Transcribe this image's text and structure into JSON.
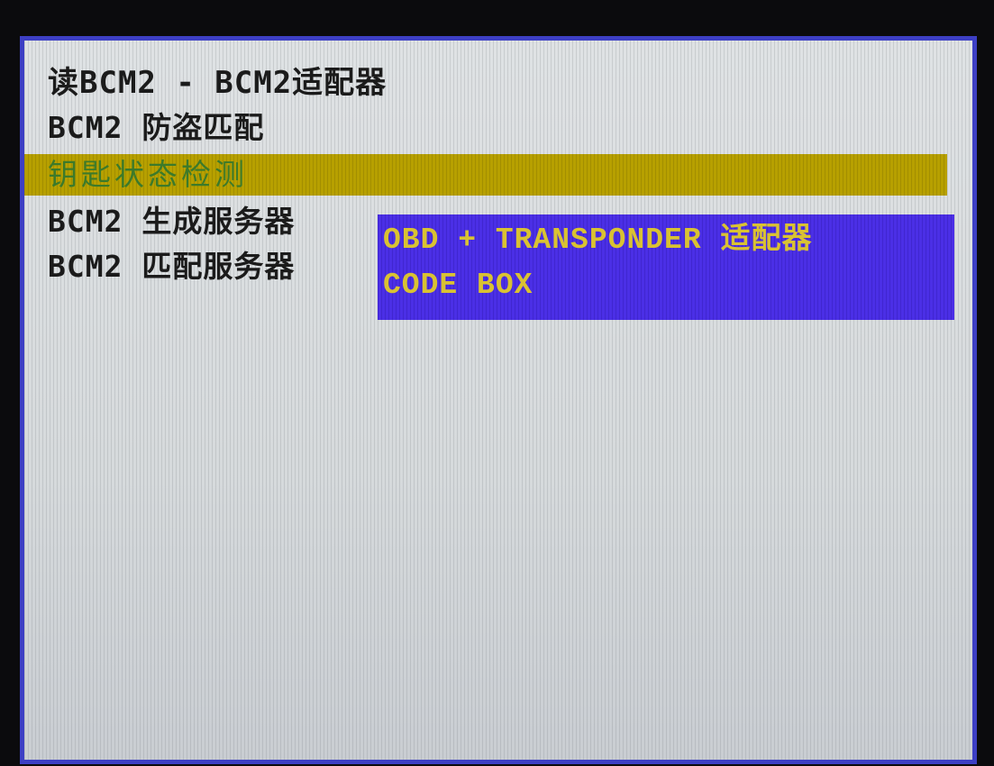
{
  "menu": {
    "items": [
      {
        "label": "读BCM2 - BCM2适配器"
      },
      {
        "label": "BCM2 防盗匹配"
      },
      {
        "label": "钥匙状态检测"
      },
      {
        "label": "BCM2 生成服务器"
      },
      {
        "label": "BCM2 匹配服务器"
      }
    ],
    "selected_index": 2
  },
  "popup": {
    "items": [
      {
        "label": "OBD + TRANSPONDER 适配器"
      },
      {
        "label": "CODE BOX"
      }
    ]
  },
  "colors": {
    "screen_border": "#3d3fc4",
    "screen_background": "#dcdfe2",
    "selected_bar": "#b7a000",
    "selected_text": "#3c7a2a",
    "popup_background": "#4b2fe6",
    "popup_text": "#d9c232",
    "menu_text": "#1b1b1b"
  }
}
